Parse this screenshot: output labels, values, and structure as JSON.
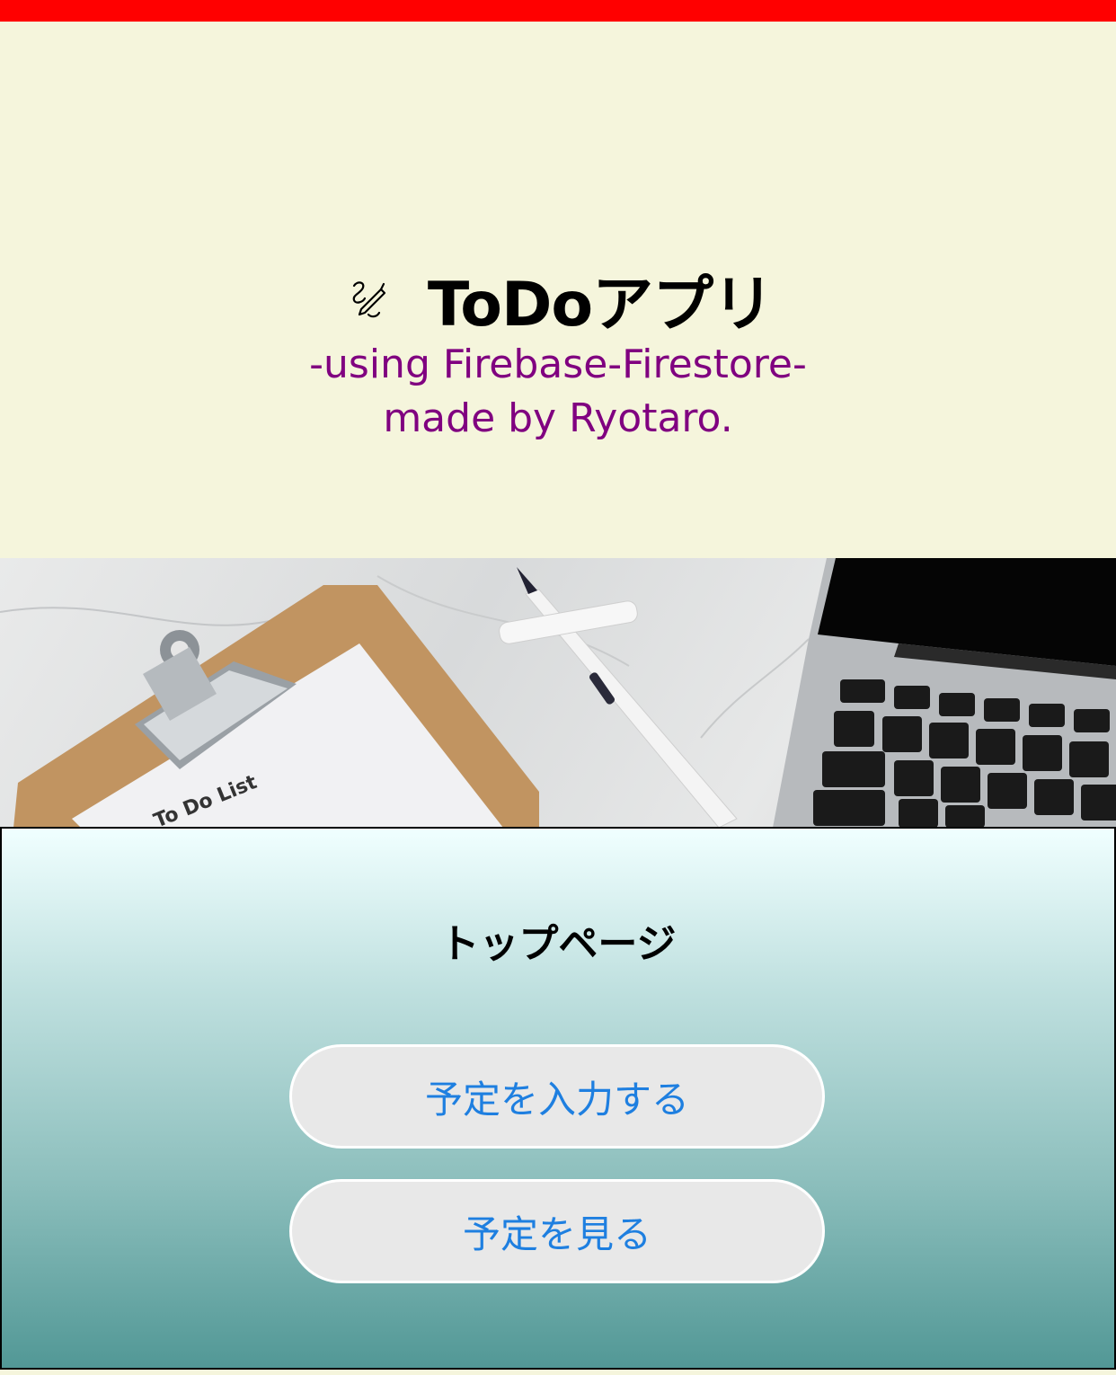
{
  "header": {
    "title": "ToDoアプリ",
    "subtitle_line1": "-using Firebase-Firestore-",
    "subtitle_line2": "made by Ryotaro.",
    "icon": "edit-pencil-icon"
  },
  "hero_image": {
    "clipboard_text": "To Do List"
  },
  "panel": {
    "title": "トップページ",
    "buttons": [
      {
        "label": "予定を入力する"
      },
      {
        "label": "予定を見る"
      }
    ]
  },
  "colors": {
    "top_bar": "#ff0000",
    "background": "#f5f5dc",
    "subtitle": "#800080",
    "button_text": "#1e7fe0",
    "button_bg": "#e8e8e8"
  }
}
